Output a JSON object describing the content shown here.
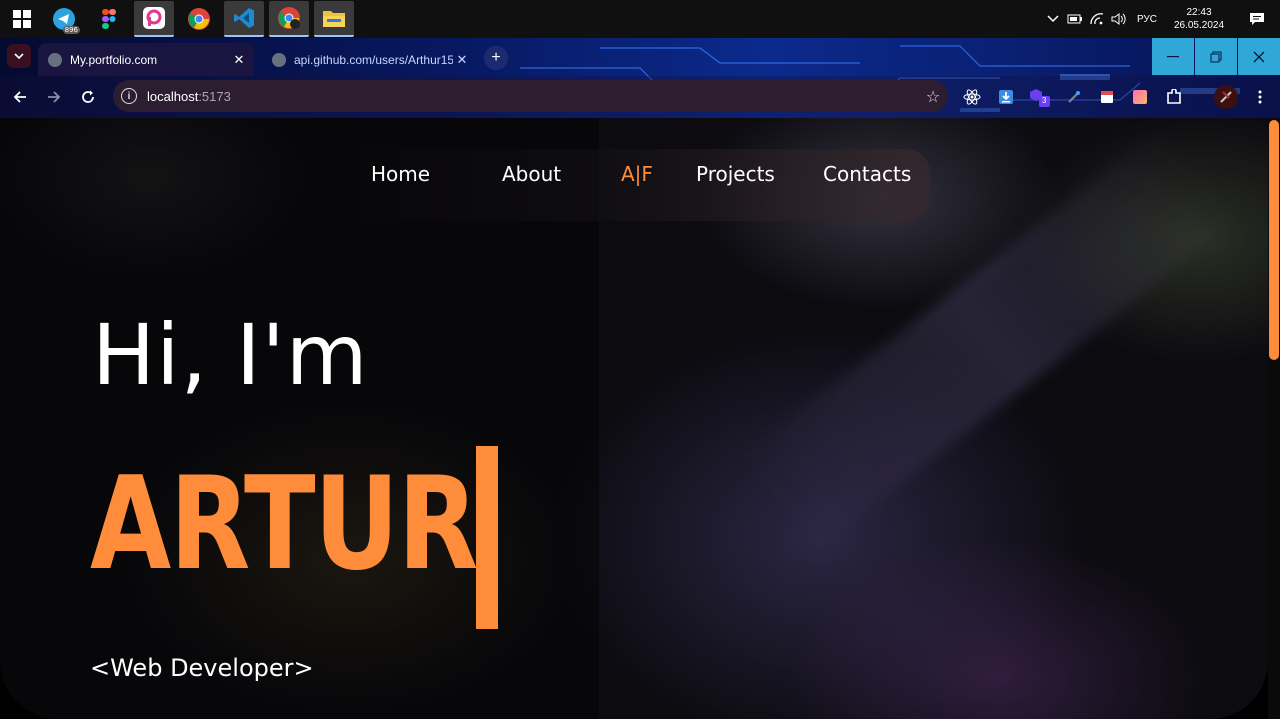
{
  "taskbar": {
    "apps": [
      {
        "name": "telegram-icon",
        "badge": "896"
      },
      {
        "name": "figma-icon"
      },
      {
        "name": "picsart-icon"
      },
      {
        "name": "chrome-icon"
      },
      {
        "name": "vscode-icon"
      },
      {
        "name": "chrome-profile-icon"
      },
      {
        "name": "file-explorer-icon"
      }
    ],
    "language": "РУС",
    "time": "22:43",
    "date": "26.05.2024"
  },
  "browser": {
    "tabs": [
      {
        "title": "My.portfolio.com",
        "active": true
      },
      {
        "title": "api.github.com/users/Arthur15",
        "active": false
      }
    ],
    "new_tab_label": "+",
    "url_host": "localhost",
    "url_port": ":5173",
    "extension_badge": "3"
  },
  "page": {
    "nav": {
      "home": "Home",
      "about": "About",
      "logo": "A|F",
      "projects": "Projects",
      "contacts": "Contacts"
    },
    "greeting": "Hi, I'm",
    "name": "ARTUR",
    "role": "<Web Developer>",
    "accent_color": "#ff8c3a"
  }
}
